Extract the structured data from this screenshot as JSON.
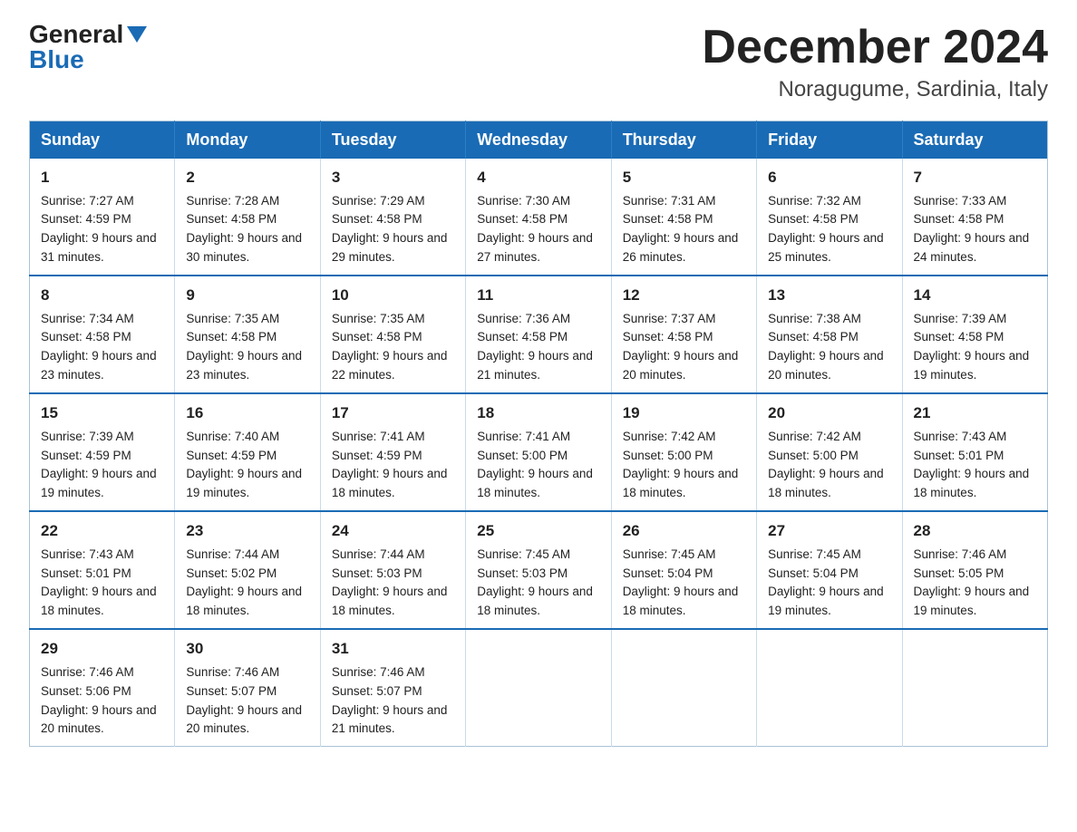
{
  "logo": {
    "general": "General",
    "blue": "Blue",
    "triangle": "▲"
  },
  "title": "December 2024",
  "location": "Noragugume, Sardinia, Italy",
  "days_of_week": [
    "Sunday",
    "Monday",
    "Tuesday",
    "Wednesday",
    "Thursday",
    "Friday",
    "Saturday"
  ],
  "weeks": [
    [
      {
        "day": "1",
        "sunrise": "7:27 AM",
        "sunset": "4:59 PM",
        "daylight": "9 hours and 31 minutes."
      },
      {
        "day": "2",
        "sunrise": "7:28 AM",
        "sunset": "4:58 PM",
        "daylight": "9 hours and 30 minutes."
      },
      {
        "day": "3",
        "sunrise": "7:29 AM",
        "sunset": "4:58 PM",
        "daylight": "9 hours and 29 minutes."
      },
      {
        "day": "4",
        "sunrise": "7:30 AM",
        "sunset": "4:58 PM",
        "daylight": "9 hours and 27 minutes."
      },
      {
        "day": "5",
        "sunrise": "7:31 AM",
        "sunset": "4:58 PM",
        "daylight": "9 hours and 26 minutes."
      },
      {
        "day": "6",
        "sunrise": "7:32 AM",
        "sunset": "4:58 PM",
        "daylight": "9 hours and 25 minutes."
      },
      {
        "day": "7",
        "sunrise": "7:33 AM",
        "sunset": "4:58 PM",
        "daylight": "9 hours and 24 minutes."
      }
    ],
    [
      {
        "day": "8",
        "sunrise": "7:34 AM",
        "sunset": "4:58 PM",
        "daylight": "9 hours and 23 minutes."
      },
      {
        "day": "9",
        "sunrise": "7:35 AM",
        "sunset": "4:58 PM",
        "daylight": "9 hours and 23 minutes."
      },
      {
        "day": "10",
        "sunrise": "7:35 AM",
        "sunset": "4:58 PM",
        "daylight": "9 hours and 22 minutes."
      },
      {
        "day": "11",
        "sunrise": "7:36 AM",
        "sunset": "4:58 PM",
        "daylight": "9 hours and 21 minutes."
      },
      {
        "day": "12",
        "sunrise": "7:37 AM",
        "sunset": "4:58 PM",
        "daylight": "9 hours and 20 minutes."
      },
      {
        "day": "13",
        "sunrise": "7:38 AM",
        "sunset": "4:58 PM",
        "daylight": "9 hours and 20 minutes."
      },
      {
        "day": "14",
        "sunrise": "7:39 AM",
        "sunset": "4:58 PM",
        "daylight": "9 hours and 19 minutes."
      }
    ],
    [
      {
        "day": "15",
        "sunrise": "7:39 AM",
        "sunset": "4:59 PM",
        "daylight": "9 hours and 19 minutes."
      },
      {
        "day": "16",
        "sunrise": "7:40 AM",
        "sunset": "4:59 PM",
        "daylight": "9 hours and 19 minutes."
      },
      {
        "day": "17",
        "sunrise": "7:41 AM",
        "sunset": "4:59 PM",
        "daylight": "9 hours and 18 minutes."
      },
      {
        "day": "18",
        "sunrise": "7:41 AM",
        "sunset": "5:00 PM",
        "daylight": "9 hours and 18 minutes."
      },
      {
        "day": "19",
        "sunrise": "7:42 AM",
        "sunset": "5:00 PM",
        "daylight": "9 hours and 18 minutes."
      },
      {
        "day": "20",
        "sunrise": "7:42 AM",
        "sunset": "5:00 PM",
        "daylight": "9 hours and 18 minutes."
      },
      {
        "day": "21",
        "sunrise": "7:43 AM",
        "sunset": "5:01 PM",
        "daylight": "9 hours and 18 minutes."
      }
    ],
    [
      {
        "day": "22",
        "sunrise": "7:43 AM",
        "sunset": "5:01 PM",
        "daylight": "9 hours and 18 minutes."
      },
      {
        "day": "23",
        "sunrise": "7:44 AM",
        "sunset": "5:02 PM",
        "daylight": "9 hours and 18 minutes."
      },
      {
        "day": "24",
        "sunrise": "7:44 AM",
        "sunset": "5:03 PM",
        "daylight": "9 hours and 18 minutes."
      },
      {
        "day": "25",
        "sunrise": "7:45 AM",
        "sunset": "5:03 PM",
        "daylight": "9 hours and 18 minutes."
      },
      {
        "day": "26",
        "sunrise": "7:45 AM",
        "sunset": "5:04 PM",
        "daylight": "9 hours and 18 minutes."
      },
      {
        "day": "27",
        "sunrise": "7:45 AM",
        "sunset": "5:04 PM",
        "daylight": "9 hours and 19 minutes."
      },
      {
        "day": "28",
        "sunrise": "7:46 AM",
        "sunset": "5:05 PM",
        "daylight": "9 hours and 19 minutes."
      }
    ],
    [
      {
        "day": "29",
        "sunrise": "7:46 AM",
        "sunset": "5:06 PM",
        "daylight": "9 hours and 20 minutes."
      },
      {
        "day": "30",
        "sunrise": "7:46 AM",
        "sunset": "5:07 PM",
        "daylight": "9 hours and 20 minutes."
      },
      {
        "day": "31",
        "sunrise": "7:46 AM",
        "sunset": "5:07 PM",
        "daylight": "9 hours and 21 minutes."
      },
      null,
      null,
      null,
      null
    ]
  ],
  "labels": {
    "sunrise_prefix": "Sunrise: ",
    "sunset_prefix": "Sunset: ",
    "daylight_prefix": "Daylight: "
  }
}
